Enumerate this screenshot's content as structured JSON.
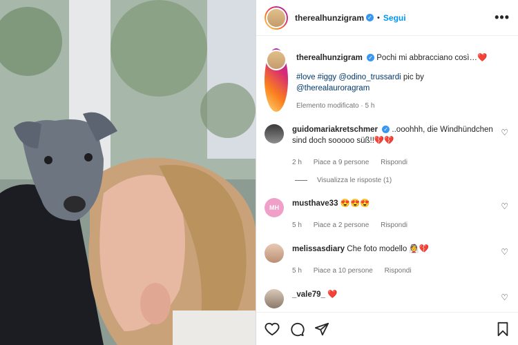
{
  "post": {
    "author": "therealhunzigram",
    "follow_label": "Segui",
    "separator": "•",
    "more_label": "•••"
  },
  "caption": {
    "author": "therealhunzigram",
    "text": "Pochi mi abbracciano così…",
    "emoji": "❤️",
    "tags": "#love #iggy @odino_trussardi",
    "pic_by": "pic by",
    "credit": "@therealauroragram",
    "edited": "Elemento modificato · 5 h"
  },
  "comments": [
    {
      "user": "guidomariakretschmer",
      "text": "..ooohhh, die Windhündchen sind doch sooooo süß!!💔💔",
      "time": "2 h",
      "likes": "Piace a 9 persone",
      "reply": "Rispondi",
      "view_replies": "Visualizza le risposte (1)",
      "verified": true
    },
    {
      "user": "musthave33",
      "text": "😍😍😍",
      "time": "5 h",
      "likes": "Piace a 2 persone",
      "reply": "Rispondi",
      "avatar_text": "MH"
    },
    {
      "user": "melissasdiary",
      "text": "Che foto modello 👰💔",
      "time": "5 h",
      "likes": "Piace a 10 persone",
      "reply": "Rispondi"
    },
    {
      "user": "_vale79_",
      "text": "❤️"
    }
  ],
  "icons": {
    "verified": "✓",
    "heart": "♡"
  },
  "colors": {
    "accent": "#0095f6",
    "verified": "#3897f0",
    "musthave_avatar": "#f0a0c8"
  }
}
